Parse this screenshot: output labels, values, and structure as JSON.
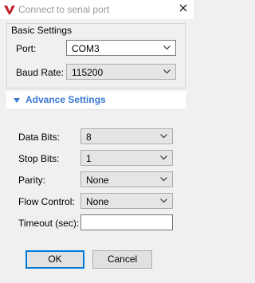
{
  "window": {
    "title": "Connect to serial port",
    "app_icon": "red-v-logo-icon",
    "close_icon": "close-icon"
  },
  "basic": {
    "title": "Basic Settings",
    "port_label": "Port:",
    "port_value": "COM3",
    "baud_label": "Baud Rate:",
    "baud_value": "115200"
  },
  "advance": {
    "title": "Advance Settings",
    "expanded": true,
    "data_bits_label": "Data Bits:",
    "data_bits_value": "8",
    "stop_bits_label": "Stop Bits:",
    "stop_bits_value": "1",
    "parity_label": "Parity:",
    "parity_value": "None",
    "flow_label": "Flow Control:",
    "flow_value": "None",
    "timeout_label": "Timeout (sec):",
    "timeout_value": ""
  },
  "buttons": {
    "ok": "OK",
    "cancel": "Cancel"
  },
  "colors": {
    "accent": "#3a78d2",
    "logo": "#c0262d"
  }
}
